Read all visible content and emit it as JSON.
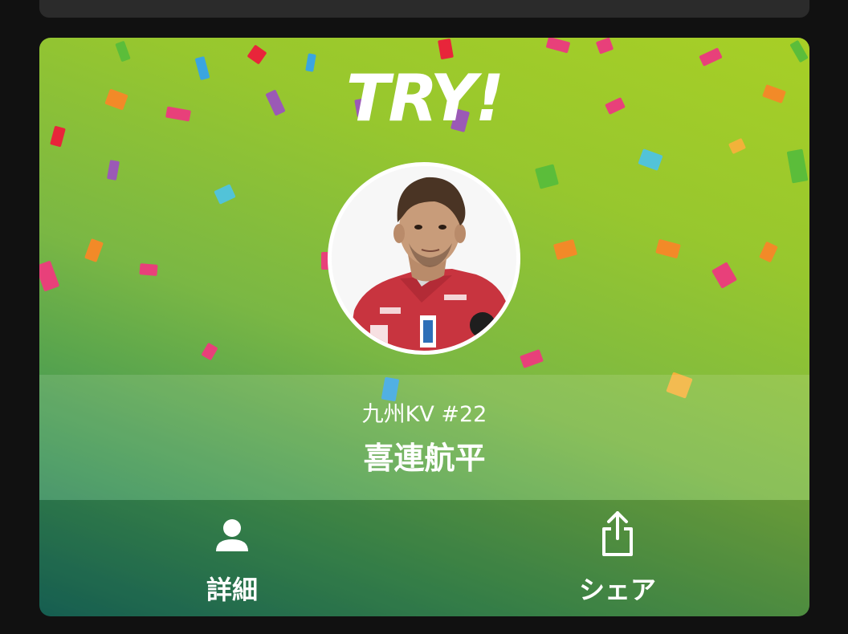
{
  "card": {
    "headline": "TRY!",
    "team_number": "九州KV #22",
    "player_name": "喜連航平"
  },
  "actions": {
    "details_label": "詳細",
    "share_label": "シェア"
  },
  "icons": {
    "details": "person-icon",
    "share": "share-icon"
  },
  "colors": {
    "gradient_light": "#a7cf26",
    "gradient_dark": "#1a7061",
    "jersey": "#c8343f"
  }
}
